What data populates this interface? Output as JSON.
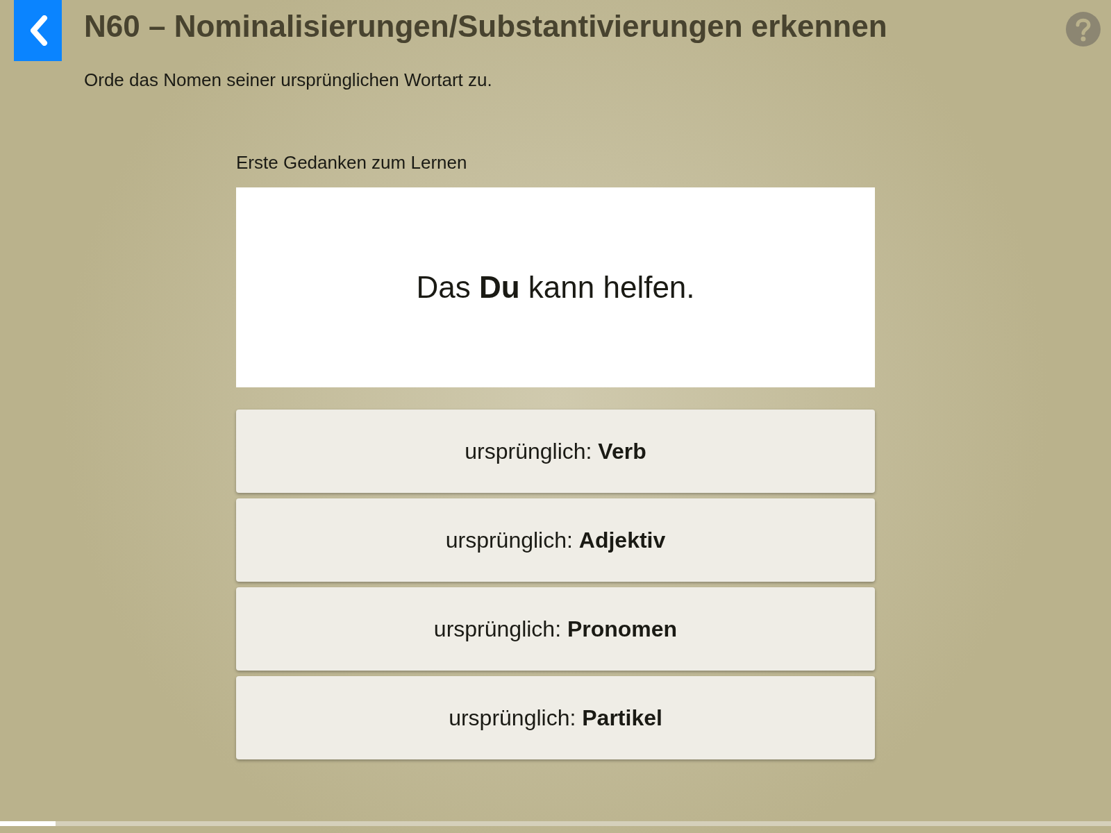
{
  "header": {
    "title": "N60 – Nominalisierungen/Substantivierungen erkennen",
    "instruction": "Orde das Nomen seiner ursprünglichen Wortart zu."
  },
  "task": {
    "label": "Erste Gedanken zum Lernen",
    "sentence": "Das **Du** kann helfen."
  },
  "options": [
    {
      "label": "ursprünglich: **Verb**"
    },
    {
      "label": "ursprünglich: **Adjektiv**"
    },
    {
      "label": "ursprünglich: **Pronomen**"
    },
    {
      "label": "ursprünglich: **Partikel**"
    }
  ],
  "progress": {
    "level": 0.05
  }
}
